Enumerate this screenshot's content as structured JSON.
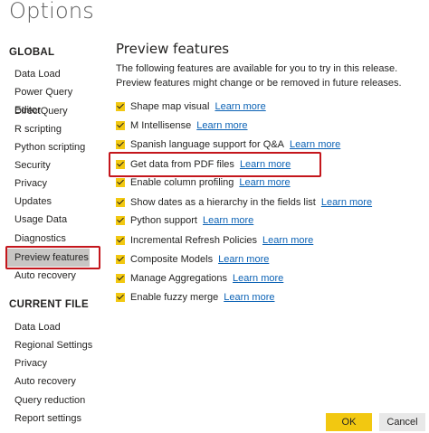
{
  "window": {
    "title": "Options"
  },
  "sidebar": {
    "global_header": "GLOBAL",
    "global_items": [
      "Data Load",
      "Power Query Editor",
      "DirectQuery",
      "R scripting",
      "Python scripting",
      "Security",
      "Privacy",
      "Updates",
      "Usage Data",
      "Diagnostics",
      "Preview features",
      "Auto recovery"
    ],
    "selected_item": "Preview features",
    "current_file_header": "CURRENT FILE",
    "current_file_items": [
      "Data Load",
      "Regional Settings",
      "Privacy",
      "Auto recovery",
      "Query reduction",
      "Report settings"
    ]
  },
  "main": {
    "title": "Preview features",
    "description": "The following features are available for you to try in this release. Preview features might change or be removed in future releases.",
    "link_text": "Learn more",
    "features": [
      {
        "label": "Shape map visual",
        "checked": true
      },
      {
        "label": "M Intellisense",
        "checked": true
      },
      {
        "label": "Spanish language support for Q&A",
        "checked": true
      },
      {
        "label": "Get data from PDF files",
        "checked": true
      },
      {
        "label": "Enable column profiling",
        "checked": true
      },
      {
        "label": "Show dates as a hierarchy in the fields list",
        "checked": true
      },
      {
        "label": "Python support",
        "checked": true
      },
      {
        "label": "Incremental Refresh Policies",
        "checked": true
      },
      {
        "label": "Composite Models",
        "checked": true
      },
      {
        "label": "Manage Aggregations",
        "checked": true
      },
      {
        "label": "Enable fuzzy merge",
        "checked": true
      }
    ],
    "highlighted_feature": "Get data from PDF files"
  },
  "footer": {
    "ok_label": "OK",
    "cancel_label": "Cancel"
  },
  "colors": {
    "accent": "#f2c811",
    "link": "#0b62b5",
    "highlight": "#c4161c",
    "selected": "#c8c6c4"
  }
}
